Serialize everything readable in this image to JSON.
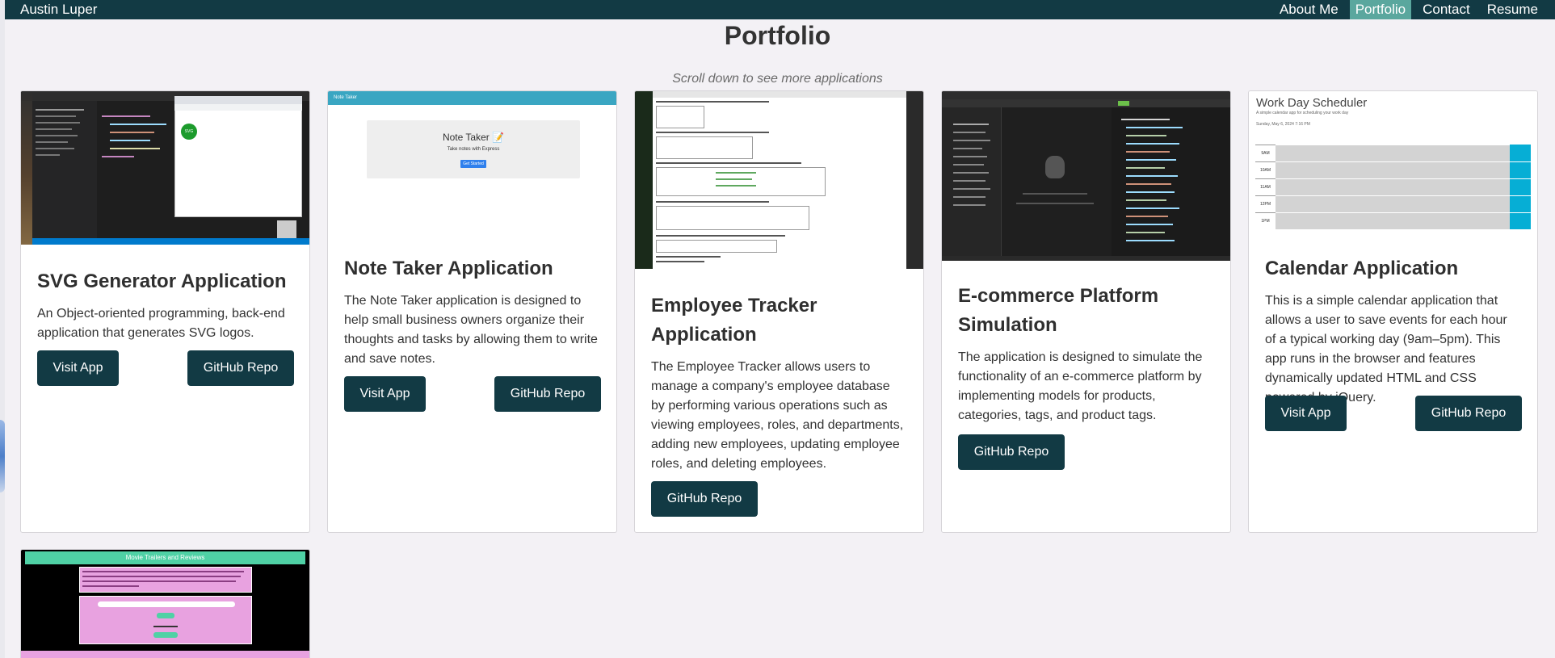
{
  "nav": {
    "brand": "Austin Luper",
    "links": [
      "About Me",
      "Portfolio",
      "Contact",
      "Resume"
    ]
  },
  "header": {
    "title": "Portfolio",
    "subtitle": "Scroll down to see more applications"
  },
  "cards": [
    {
      "title": "SVG Generator Application",
      "text": "An Object-oriented programming, back-end application that generates SVG logos.",
      "visit": "Visit App",
      "repo": "GitHub Repo",
      "shot_label": "SVG"
    },
    {
      "title": "Note Taker Application",
      "text": "The Note Taker application is designed to help small business owners organize their thoughts and tasks by allowing them to write and save notes.",
      "visit": "Visit App",
      "repo": "GitHub Repo",
      "shot_header": "Note Taker",
      "shot_title": "Note Taker 📝",
      "shot_sub": "Take notes with Express",
      "shot_btn": "Get Started"
    },
    {
      "title": "Employee Tracker Application",
      "text": "The Employee Tracker allows users to manage a company's employee database by performing various operations such as viewing employees, roles, and departments, adding new employees, updating employee roles, and deleting employees.",
      "repo": "GitHub Repo"
    },
    {
      "title": "E-commerce Platform Simulation",
      "text": "The application is designed to simulate the functionality of an e-commerce platform by implementing models for products, categories, tags, and product tags.",
      "repo": "GitHub Repo"
    },
    {
      "title": "Calendar Application",
      "text": "This is a simple calendar application that allows a user to save events for each hour of a typical working day (9am–5pm). This app runs in the browser and features dynamically updated HTML and CSS powered by jQuery.",
      "visit": "Visit App",
      "repo": "GitHub Repo",
      "shot_title": "Work Day Scheduler",
      "shot_sub": "A simple calendar app for scheduling your work day",
      "shot_date": "Sunday, May 6, 2024 7:16 PM",
      "hours": [
        "9AM",
        "10AM",
        "11AM",
        "12PM",
        "1PM"
      ]
    },
    {
      "shot_title": "Movie Trailers and Reviews"
    }
  ],
  "colors": {
    "nav_bg": "#123a44",
    "nav_active": "#5aa79e",
    "button_bg": "#123a44",
    "page_bg": "#f3f1f5"
  }
}
